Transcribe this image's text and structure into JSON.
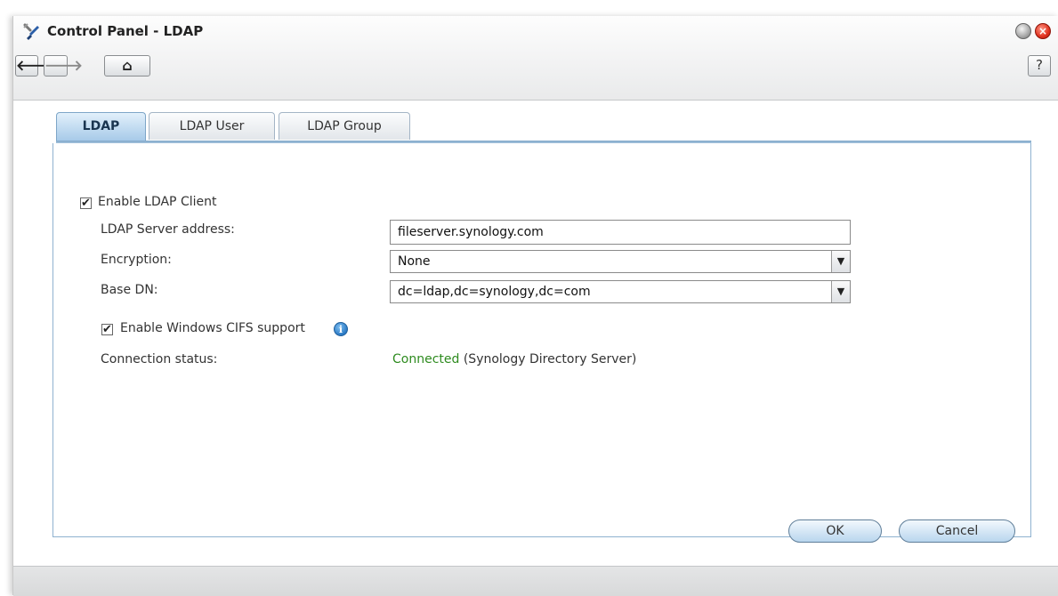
{
  "window": {
    "title": "Control Panel - LDAP",
    "icon": "tools-icon",
    "close_glyph": "×"
  },
  "toolbar": {
    "back_glyph": "🡐",
    "forward_glyph": "🡒",
    "home_glyph": "⌂",
    "help_label": "?"
  },
  "tabs": [
    {
      "label": "LDAP",
      "active": true
    },
    {
      "label": "LDAP User",
      "active": false
    },
    {
      "label": "LDAP Group",
      "active": false
    }
  ],
  "form": {
    "enable_client": {
      "label": "Enable LDAP Client",
      "checked": true,
      "mark": "✔"
    },
    "server_address": {
      "label": "LDAP Server address:",
      "value": "fileserver.synology.com"
    },
    "encryption": {
      "label": "Encryption:",
      "value": "None"
    },
    "base_dn": {
      "label": "Base DN:",
      "value": "dc=ldap,dc=synology,dc=com"
    },
    "cifs_support": {
      "label": "Enable Windows CIFS support",
      "checked": true,
      "mark": "✔",
      "info_glyph": "i"
    },
    "connection_status": {
      "label": "Connection status:",
      "state": "Connected",
      "detail": "(Synology Directory Server)"
    },
    "dropdown_glyph": "▼"
  },
  "buttons": {
    "ok": "OK",
    "cancel": "Cancel"
  },
  "colors": {
    "status_connected": "#2e8b1f",
    "active_tab": "#a5c9e8"
  }
}
